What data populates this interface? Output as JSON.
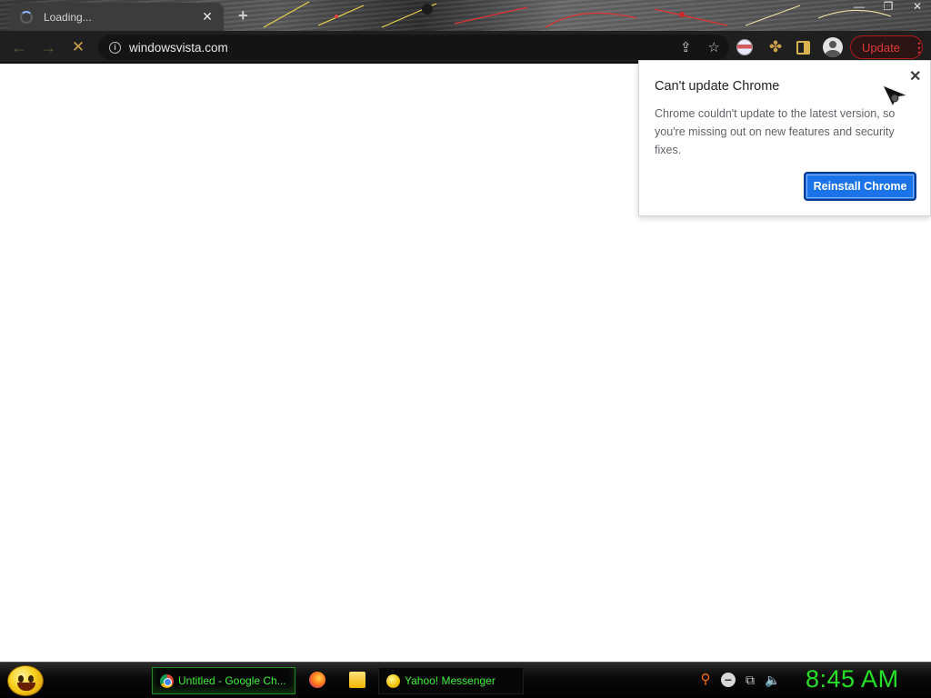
{
  "browser": {
    "tab": {
      "title": "Loading...",
      "close_glyph": "✕"
    },
    "new_tab_glyph": "+",
    "window_controls": [
      "—",
      "❐",
      "✕"
    ],
    "toolbar": {
      "back_glyph": "←",
      "forward_glyph": "→",
      "stop_glyph": "✕",
      "url": "windowsvista.com",
      "info_glyph": "i",
      "share_glyph": "⇪",
      "bookmark_glyph": "☆",
      "update_label": "Update",
      "menu_glyph": "⋮"
    }
  },
  "popup": {
    "title": "Can't update Chrome",
    "body": "Chrome couldn't update to the latest version, so you're missing out on new features and security fixes.",
    "close_glyph": "✕",
    "button_label": "Reinstall Chrome"
  },
  "taskbar": {
    "items": [
      {
        "label": "Untitled - Google Ch...",
        "icon": "chrome-icon",
        "active": true
      },
      {
        "label": "Yahoo! Messenger",
        "icon": "yahoo-messenger-icon",
        "active": false
      }
    ],
    "quick_launch": [
      "firefox-icon",
      "folder-icon"
    ],
    "tray": [
      "search-icon",
      "minus-circle-icon",
      "network-icon",
      "volume-icon"
    ],
    "clock": "8:45 AM"
  },
  "colors": {
    "accent_blue": "#1a73e8",
    "update_red": "#e23a3a",
    "taskbar_text_green": "#3ff23f",
    "clock_green": "#26e026"
  }
}
